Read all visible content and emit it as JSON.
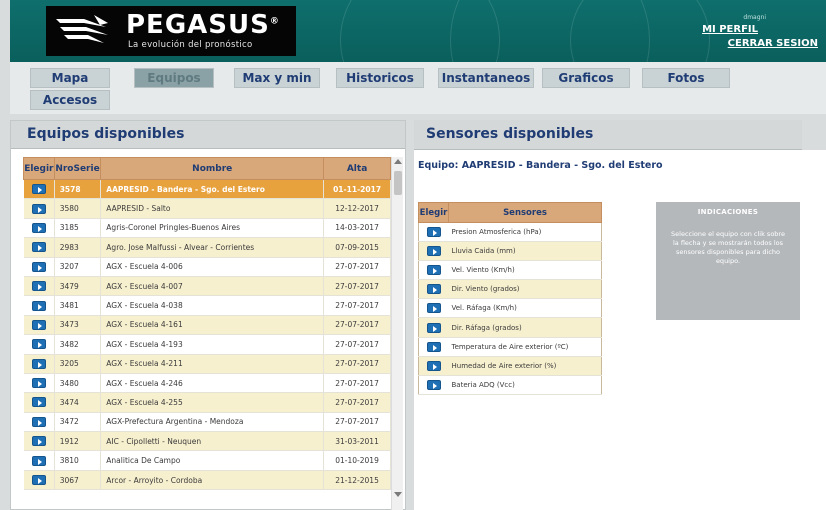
{
  "brand": {
    "title": "PEGASUS",
    "reg": "®",
    "subtitle": "La evolución del pronóstico"
  },
  "user": {
    "small_label": "dmagni",
    "profile_link": "MI PERFIL",
    "logout_link": "CERRAR SESION"
  },
  "nav": {
    "items": [
      {
        "label": "Mapa"
      },
      {
        "label": "Equipos"
      },
      {
        "label": "Max y min"
      },
      {
        "label": "Historicos"
      },
      {
        "label": "Instantaneos"
      },
      {
        "label": "Graficos"
      },
      {
        "label": "Fotos"
      },
      {
        "label": "Accesos"
      }
    ],
    "active": "Equipos"
  },
  "equipos": {
    "title": "Equipos disponibles",
    "headers": [
      "Elegir",
      "NroSerie",
      "Nombre",
      "Alta"
    ],
    "rows": [
      {
        "serie": "3578",
        "nombre": "AAPRESID - Bandera - Sgo. del Estero",
        "alta": "01-11-2017",
        "selected": true
      },
      {
        "serie": "3580",
        "nombre": "AAPRESID - Salto",
        "alta": "12-12-2017"
      },
      {
        "serie": "3185",
        "nombre": "Agris-Coronel Pringles-Buenos Aires",
        "alta": "14-03-2017"
      },
      {
        "serie": "2983",
        "nombre": "Agro. Jose Malfussi - Alvear - Corrientes",
        "alta": "07-09-2015"
      },
      {
        "serie": "3207",
        "nombre": "AGX - Escuela 4-006",
        "alta": "27-07-2017"
      },
      {
        "serie": "3479",
        "nombre": "AGX - Escuela 4-007",
        "alta": "27-07-2017"
      },
      {
        "serie": "3481",
        "nombre": "AGX - Escuela 4-038",
        "alta": "27-07-2017"
      },
      {
        "serie": "3473",
        "nombre": "AGX - Escuela 4-161",
        "alta": "27-07-2017"
      },
      {
        "serie": "3482",
        "nombre": "AGX - Escuela 4-193",
        "alta": "27-07-2017"
      },
      {
        "serie": "3205",
        "nombre": "AGX - Escuela 4-211",
        "alta": "27-07-2017"
      },
      {
        "serie": "3480",
        "nombre": "AGX - Escuela 4-246",
        "alta": "27-07-2017"
      },
      {
        "serie": "3474",
        "nombre": "AGX - Escuela 4-255",
        "alta": "27-07-2017"
      },
      {
        "serie": "3472",
        "nombre": "AGX-Prefectura Argentina - Mendoza",
        "alta": "27-07-2017"
      },
      {
        "serie": "1912",
        "nombre": "AIC - Cipolletti - Neuquen",
        "alta": "31-03-2011"
      },
      {
        "serie": "3810",
        "nombre": "Analitica De Campo",
        "alta": "01-10-2019"
      },
      {
        "serie": "3067",
        "nombre": "Arcor - Arroyito - Cordoba",
        "alta": "21-12-2015"
      }
    ]
  },
  "sensores": {
    "title": "Sensores disponibles",
    "equipo_line": "Equipo: AAPRESID - Bandera - Sgo. del Estero",
    "headers": [
      "Elegir",
      "Sensores"
    ],
    "rows": [
      "Presion Atmosferica (hPa)",
      "Lluvia Caida (mm)",
      "Vel. Viento (Km/h)",
      "Dir. Viento (grados)",
      "Vel. Ráfaga (Km/h)",
      "Dir. Ráfaga (grados)",
      "Temperatura de Aire exterior (ºC)",
      "Humedad de Aire exterior (%)",
      "Bateria ADQ (Vcc)"
    ]
  },
  "indicaciones": {
    "title": "INDICACIONES",
    "text": "Seleccione el equipo con clik sobre la flecha y se mostrarán todos los sensores disponibles para dicho equipo."
  },
  "colors": {
    "header_bg": "#0a5f5c",
    "accent_orange": "#e8a23d",
    "table_header": "#d8a77a",
    "row_alt": "#f7f0cf",
    "title_blue": "#1f3c74",
    "arrow_blue": "#1f6fb5"
  }
}
